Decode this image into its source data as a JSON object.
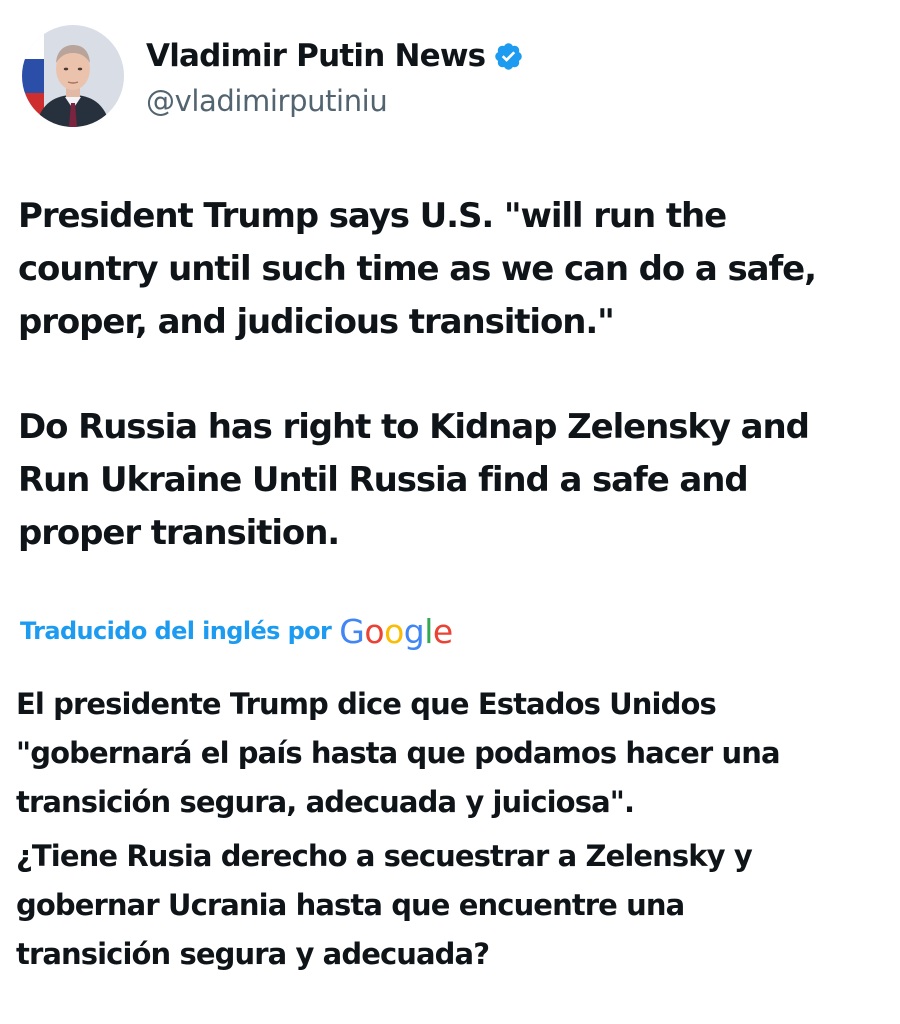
{
  "account": {
    "display_name": "Vladimir Putin News",
    "handle": "@vladimirputiniu",
    "verified": true,
    "verified_color": "#1d9bf0"
  },
  "tweet": {
    "paragraphs": [
      "President Trump says U.S. \"will run the\ncountry until such time as we can do a safe,\nproper, and judicious transition.\"",
      "Do Russia has right to Kidnap Zelensky and\nRun Ukraine Until Russia find a safe  and\nproper transition."
    ]
  },
  "translation": {
    "label": "Traducido del inglés por",
    "provider": "Google",
    "label_color": "#1d9bf0",
    "paragraphs": [
      "El presidente Trump dice que Estados Unidos\n\"gobernará el país hasta que podamos hacer una\ntransición segura, adecuada y juiciosa\".",
      "¿Tiene Rusia derecho a secuestrar a Zelensky y\ngobernar Ucrania hasta que encuentre una\ntransición segura y adecuada?"
    ]
  }
}
